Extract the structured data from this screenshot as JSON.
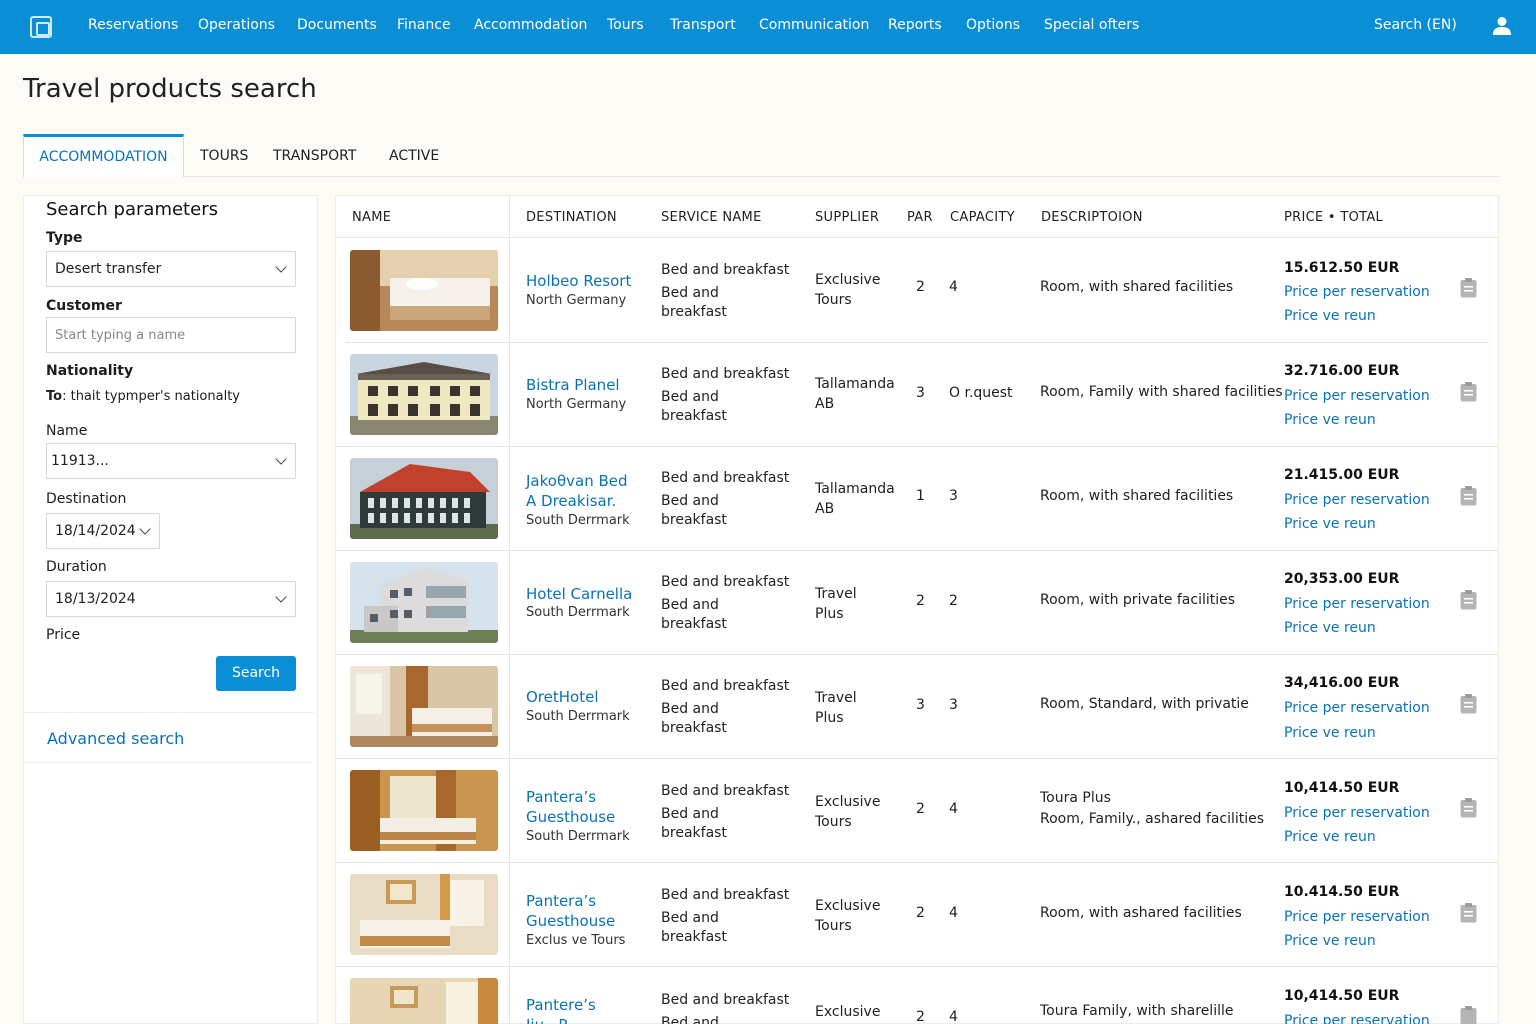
{
  "nav": {
    "items": [
      "Reservations",
      "Operations",
      "Documents",
      "Finance",
      "Accommodation",
      "Tours",
      "Transport",
      "Communication",
      "Reports",
      "Options",
      "Special ofters"
    ],
    "search": "Search (EN)"
  },
  "page_title": "Travel products search",
  "tabs": [
    "ACCOMMODATION",
    "TOURS",
    "TRANSPORT",
    "ACTIVE"
  ],
  "search_params": {
    "title": "Search parameters",
    "type_label": "Type",
    "type_value": "Desert transfer",
    "customer_label": "Customer",
    "customer_placeholder": "Start typing a name",
    "nationality_label": "Nationality",
    "nationality_prefix": "To",
    "nationality_value": ": thait typmper's nationalty",
    "name_label": "Name",
    "name_value": "11913...",
    "destination_label": "Destination",
    "destination_value": "18/14/2024",
    "duration_label": "Duration",
    "duration_value": "18/13/2024",
    "price_label": "Price",
    "search_button": "Search",
    "advanced_search": "Advanced search"
  },
  "table": {
    "headers": [
      "NAME",
      "DESTINATION",
      "SERVICE NAME",
      "SUPPLIER",
      "PAR",
      "CAPACITY",
      "DESCRIPTOION",
      "PRICE • TOTAL"
    ],
    "rows": [
      {
        "dest1": "Holbeo Resort",
        "dest2": "",
        "region": "North Germany",
        "svc1": "Bed and breakfast",
        "svc2": "Bed and",
        "svc3": "breakfast",
        "sup1": "Exclusive",
        "sup2": "Tours",
        "par": "2",
        "cap": "4",
        "desc1": "Room, with shared facilities",
        "desc2": "",
        "price": "15.612.50 EUR",
        "link1": "Price per reservation",
        "link2": "Price ve reun"
      },
      {
        "dest1": "Bistra Planel",
        "dest2": "",
        "region": "North Germany",
        "svc1": "Bed and breakfast",
        "svc2": "Bed and",
        "svc3": "breakfast",
        "sup1": "Tallamanda",
        "sup2": "AB",
        "par": "3",
        "cap": "O r.quest",
        "desc1": "Room, Family with shared facilities",
        "desc2": "",
        "price": "32.716.00 EUR",
        "link1": "Price per reservation",
        "link2": "Price ve reun"
      },
      {
        "dest1": "Jakoθvan Bed",
        "dest2": "A Dreakisar.",
        "region": "South Derrmark",
        "svc1": "Bed and breakfast",
        "svc2": "Bed and",
        "svc3": "breakfast",
        "sup1": "Tallamanda",
        "sup2": "AB",
        "par": "1",
        "cap": "3",
        "desc1": "Room, with shared facilities",
        "desc2": "",
        "price": "21.415.00 EUR",
        "link1": "Price per reservation",
        "link2": "Price ve reun"
      },
      {
        "dest1": "Hotel Carnella",
        "dest2": "",
        "region": "South Derrmark",
        "svc1": "Bed and breakfast",
        "svc2": "Bed and",
        "svc3": "breakfast",
        "sup1": "Travel",
        "sup2": "Plus",
        "par": "2",
        "cap": "2",
        "desc1": "Room, with private facilities",
        "desc2": "",
        "price": "20,353.00 EUR",
        "link1": "Price per reservation",
        "link2": "Price ve reun"
      },
      {
        "dest1": "OretHotel",
        "dest2": "",
        "region": "South Derrmark",
        "svc1": "Bed and breakfast",
        "svc2": "Bed and",
        "svc3": "breakfast",
        "sup1": "Travel",
        "sup2": "Plus",
        "par": "3",
        "cap": "3",
        "desc1": "Room, Standard, with privatie",
        "desc2": "",
        "price": "34,416.00 EUR",
        "link1": "Price per reservation",
        "link2": "Price ve reun"
      },
      {
        "dest1": "Pantera’s",
        "dest2": "Guesthouse",
        "region": "South Derrmark",
        "svc1": "Bed and breakfast",
        "svc2": "Bed and",
        "svc3": "breakfast",
        "sup1": "Exclusive",
        "sup2": "Tours",
        "par": "2",
        "cap": "4",
        "desc1": "Toura Plus",
        "desc2": "Room, Family., ashared facilities",
        "price": "10,414.50 EUR",
        "link1": "Price per reservation",
        "link2": "Price ve reun"
      },
      {
        "dest1": "Pantera’s",
        "dest2": "Guesthouse",
        "region": "Exclus ve Tours",
        "svc1": "Bed and breakfast",
        "svc2": "Bed and",
        "svc3": "breakfast",
        "sup1": "Exclusive",
        "sup2": "Tours",
        "par": "2",
        "cap": "4",
        "desc1": "Room, with ashared facilities",
        "desc2": "",
        "price": "10.414.50 EUR",
        "link1": "Price per reservation",
        "link2": "Price ve reun"
      },
      {
        "dest1": "Pantere’s",
        "dest2": "Jiu...P...",
        "region": "",
        "svc1": "Bed and breakfast",
        "svc2": "Bed and",
        "svc3": "",
        "sup1": "Exclusive",
        "sup2": "",
        "par": "2",
        "cap": "4",
        "desc1": "Toura Family, with sharelille",
        "desc2": "",
        "price": "10,414.50 EUR",
        "link1": "Price per reservation",
        "link2": ""
      }
    ]
  }
}
